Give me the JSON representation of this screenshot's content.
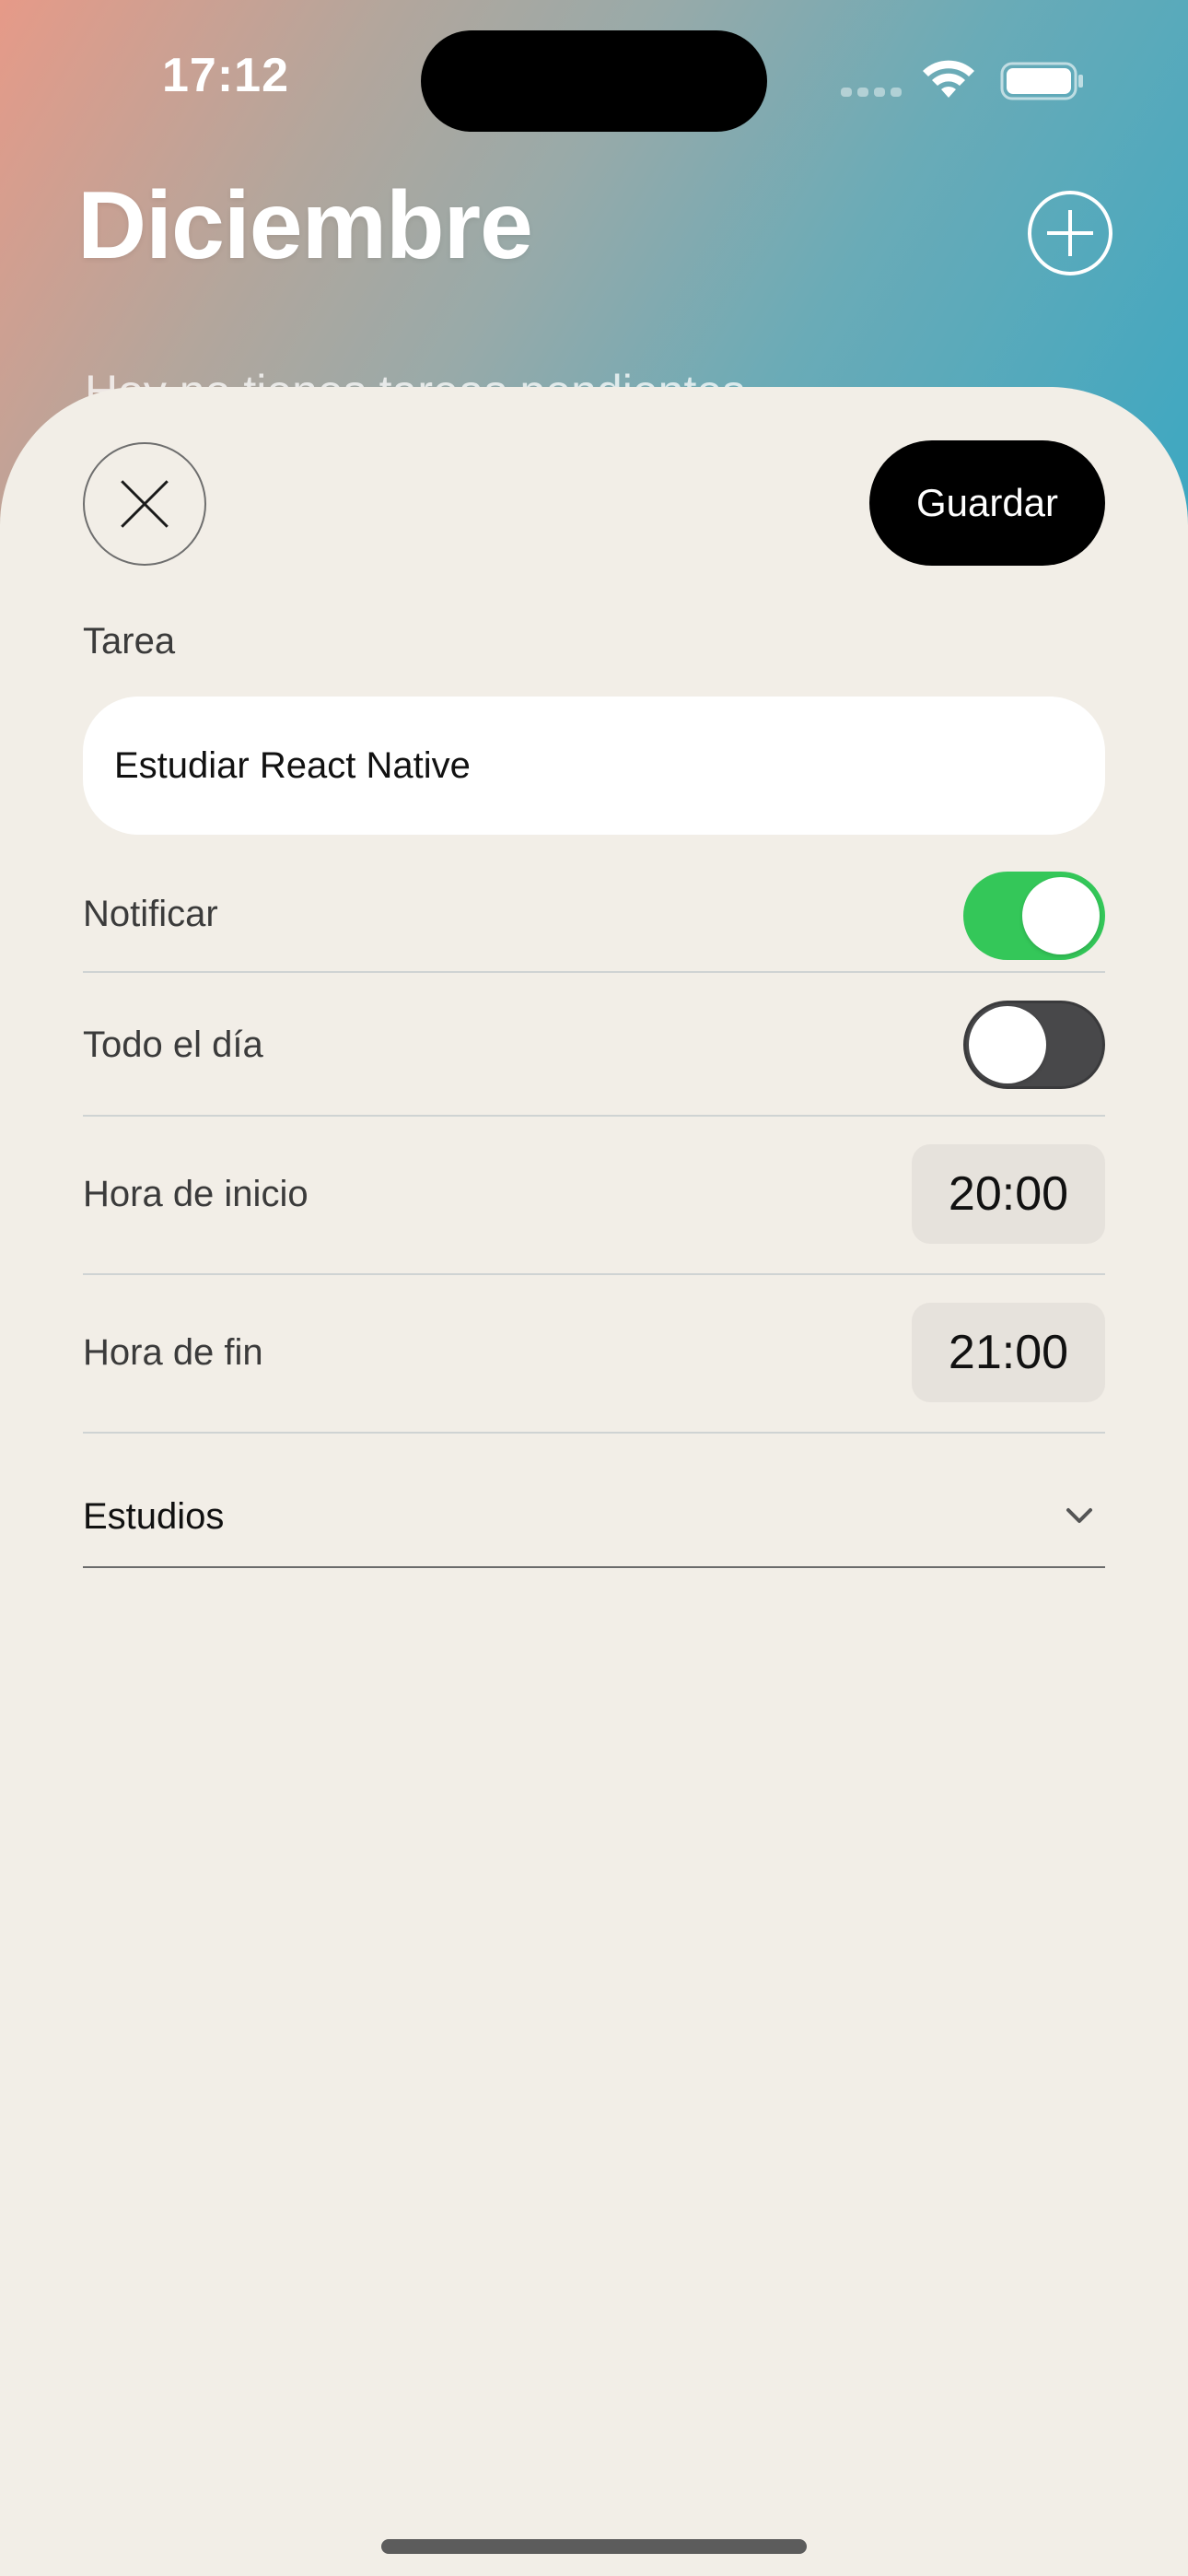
{
  "status_bar": {
    "time": "17:12"
  },
  "header": {
    "title": "Diciembre",
    "add_icon": "plus-circle-icon",
    "background_peek_text": "Hoy no tienes tareas pendientes"
  },
  "sheet": {
    "close_icon": "close-icon",
    "save_label": "Guardar",
    "task_label": "Tarea",
    "task_value": "Estudiar React Native",
    "notify": {
      "label": "Notificar",
      "value": true
    },
    "all_day": {
      "label": "Todo el día",
      "value": false
    },
    "start_time": {
      "label": "Hora de inicio",
      "value": "20:00"
    },
    "end_time": {
      "label": "Hora de fin",
      "value": "21:00"
    },
    "category": {
      "selected": "Estudios",
      "icon": "chevron-down-icon"
    }
  },
  "colors": {
    "accent_toggle_on": "#34c759",
    "sheet_background": "#f2eee7",
    "save_button": "#000000"
  }
}
